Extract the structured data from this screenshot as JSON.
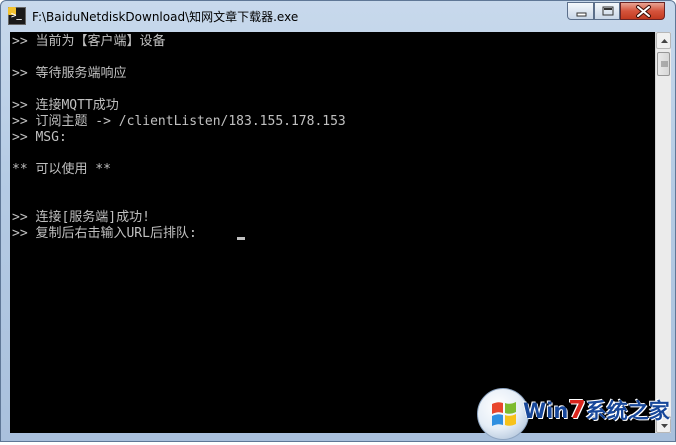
{
  "window": {
    "title": "F:\\BaiduNetdiskDownload\\知网文章下载器.exe"
  },
  "console": {
    "lines": [
      ">> 当前为【客户端】设备",
      ">> 等待服务端响应",
      ">> 连接MQTT成功",
      ">> 订阅主题 -> /clientListen/183.155.178.153",
      ">> MSG:",
      "** 可以使用 **",
      ">> 连接[服务端]成功!",
      ">> 复制后右击输入URL后排队:"
    ],
    "text_color": "#c0c0c0",
    "background": "#000000"
  },
  "watermark": {
    "brand_prefix": "Win",
    "brand_seven": "7",
    "brand_suffix": "系统之家"
  },
  "icons": {
    "app": "cmd-window-icon",
    "minimize": "minimize-icon",
    "maximize": "maximize-icon",
    "close": "close-icon"
  },
  "colors": {
    "accent_close": "#c23a20",
    "watermark_blue": "#17479a",
    "watermark_red": "#d9251c"
  }
}
